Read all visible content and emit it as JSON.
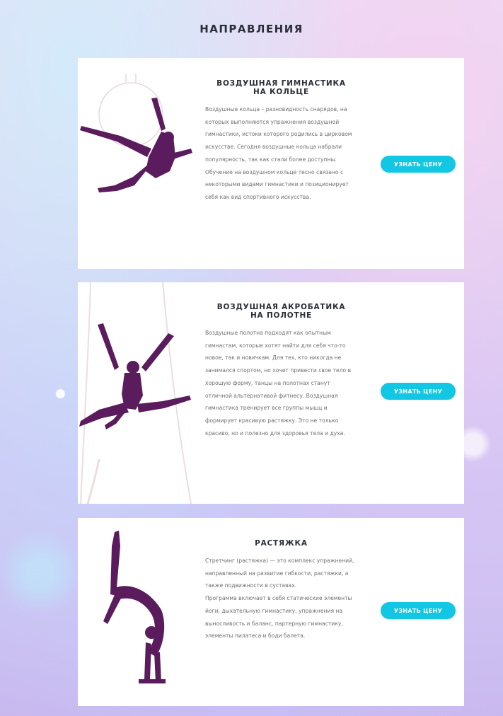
{
  "page": {
    "title": "НАПРАВЛЕНИЯ"
  },
  "colors": {
    "accent": "#12c7e3",
    "silhouette": "#5b1c5e",
    "heading": "#2a2f38",
    "body_text": "#6f6f6f",
    "card_background": "#ffffff"
  },
  "directions": [
    {
      "title_line1": "ВОЗДУШНАЯ ГИМНАСТИКА",
      "title_line2": "НА КОЛЬЦЕ",
      "text": "Воздушные кольца – разновидность снарядов, на которых выполняются упражнения воздушной гимнастики, истоки которого родились в цирковом искусстве. Сегодня воздушные кольца набрали популярность, так как стали более доступны. Обучение на воздушном кольце тесно связано с некоторыми видами гимнастики и позиционирует себя как вид спортивного искусства.",
      "button_label": "УЗНАТЬ ЦЕНУ",
      "image_icon": "aerial-hoop-silhouette-icon"
    },
    {
      "title_line1": "ВОЗДУШНАЯ АКРОБАТИКА",
      "title_line2": "НА ПОЛОТНЕ",
      "text": "Воздушные полотна подходят как опытным гимнастам, которые хотят найти для себя что-то новое, так и новичкам. Для тех, кто никогда не занимался спортом, но хочет привести свое тело в хорошую форму, танцы на полотнах станут отличной альтернативой фитнесу. Воздушная гимнастика тренирует все группы мышц и формирует красивую растяжку. Это не только красиво, но и полезно для здоровья тела и духа.",
      "button_label": "УЗНАТЬ ЦЕНУ",
      "image_icon": "aerial-silks-silhouette-icon"
    },
    {
      "title_line1": "РАСТЯЖКА",
      "title_line2": "",
      "text_line1": "Стретчинг (растяжка) — это комплекс упражнений, направленный на развитие гибкости, растяжки, а также подвижности в суставах.",
      "text_line2": "Программа включает в себя статические элементы йоги, дыхательную гимнастику, упражнения на выносливость и баланс, партерную гимнастику, элементы пилатеса и боди балета.",
      "button_label": "УЗНАТЬ ЦЕНУ",
      "image_icon": "stretching-silhouette-icon"
    }
  ]
}
